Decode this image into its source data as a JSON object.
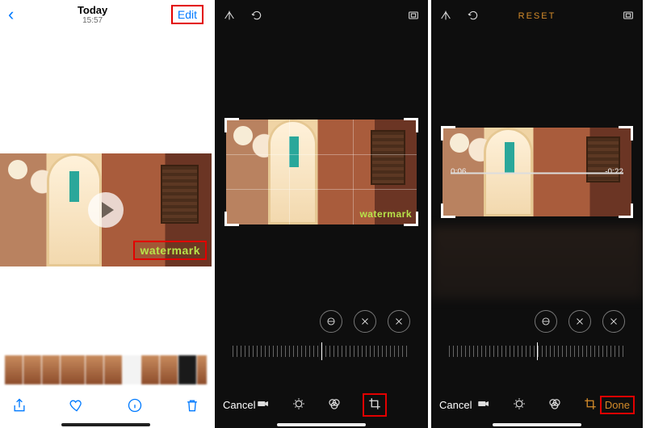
{
  "panel_a": {
    "title": "Today",
    "time": "15:57",
    "edit_label": "Edit",
    "watermark": "watermark",
    "toolbar_icons": {
      "share": "share-icon",
      "favorite": "heart-icon",
      "info": "info-icon",
      "delete": "trash-icon"
    }
  },
  "panel_b": {
    "top_icons": {
      "flip": "flip-icon",
      "rotate": "rotate-icon",
      "aspect": "aspect-icon"
    },
    "watermark": "watermark",
    "round_buttons": {
      "straighten": "straighten-icon",
      "flip_h": "flip-h-icon",
      "flip_v": "flip-v-icon"
    },
    "bottom": {
      "cancel": "Cancel",
      "tools": {
        "video": "video-icon",
        "adjust": "adjust-icon",
        "filters": "filters-icon",
        "crop": "crop-icon"
      }
    }
  },
  "panel_c": {
    "reset_label": "RESET",
    "time_current": "0:06",
    "time_remaining": "-0:22",
    "bottom": {
      "cancel": "Cancel",
      "done": "Done"
    }
  }
}
